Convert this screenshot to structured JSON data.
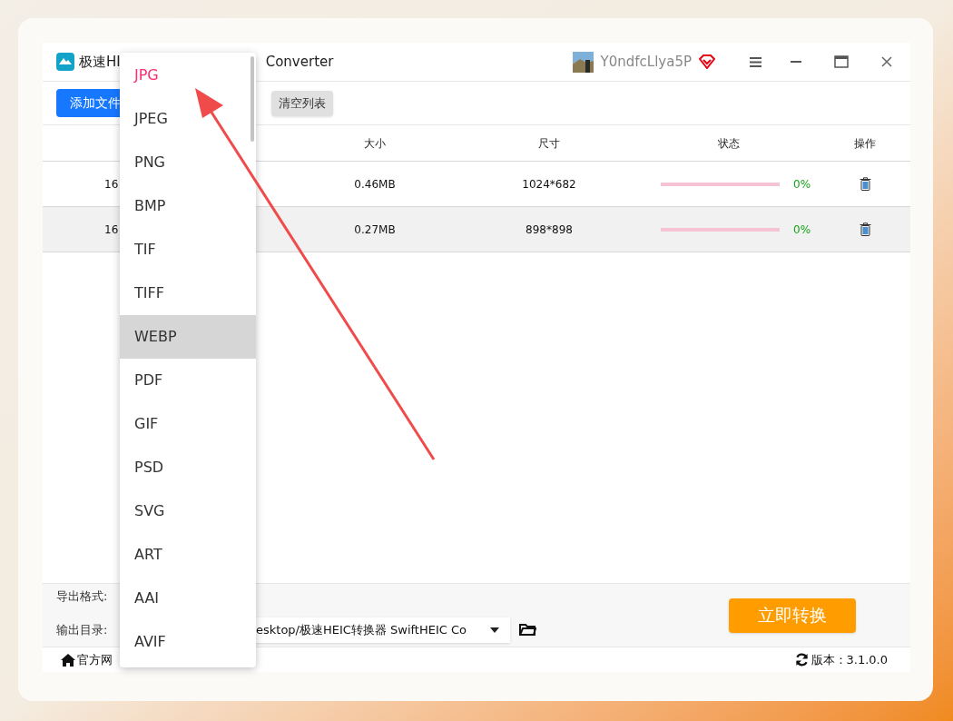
{
  "title_bar": {
    "title_start": "极速HI",
    "title_end": "Converter",
    "username": "Y0ndfcLlya5P"
  },
  "toolbar": {
    "buttons": [
      {
        "label": "添加文件",
        "kind": "primary"
      },
      {
        "label": "清空列表",
        "kind": "secondary"
      }
    ]
  },
  "table": {
    "columns": [
      "大小",
      "尺寸",
      "状态",
      "操作"
    ],
    "rows": [
      {
        "name": "16",
        "size": "0.46MB",
        "dimensions": "1024*682",
        "progress": "0%",
        "selected": false
      },
      {
        "name": "16",
        "size": "0.27MB",
        "dimensions": "898*898",
        "progress": "0%",
        "selected": true
      }
    ]
  },
  "settings": {
    "format_label": "导出格式:",
    "output_label": "输出目录:",
    "output_path": "esktop/极速HEIC转换器 SwiftHEIC Co",
    "convert_button": "立即转换"
  },
  "footer": {
    "website": "官方网",
    "version": "版本：3.1.0.0"
  },
  "format_menu": [
    {
      "label": "JPG",
      "selected": true,
      "highlighted": false
    },
    {
      "label": "JPEG",
      "selected": false,
      "highlighted": false
    },
    {
      "label": "PNG",
      "selected": false,
      "highlighted": false
    },
    {
      "label": "BMP",
      "selected": false,
      "highlighted": false
    },
    {
      "label": "TIF",
      "selected": false,
      "highlighted": false
    },
    {
      "label": "TIFF",
      "selected": false,
      "highlighted": false
    },
    {
      "label": "WEBP",
      "selected": false,
      "highlighted": true
    },
    {
      "label": "PDF",
      "selected": false,
      "highlighted": false
    },
    {
      "label": "GIF",
      "selected": false,
      "highlighted": false
    },
    {
      "label": "PSD",
      "selected": false,
      "highlighted": false
    },
    {
      "label": "SVG",
      "selected": false,
      "highlighted": false
    },
    {
      "label": "ART",
      "selected": false,
      "highlighted": false
    },
    {
      "label": "AAI",
      "selected": false,
      "highlighted": false
    },
    {
      "label": "AVIF",
      "selected": false,
      "highlighted": false
    }
  ]
}
